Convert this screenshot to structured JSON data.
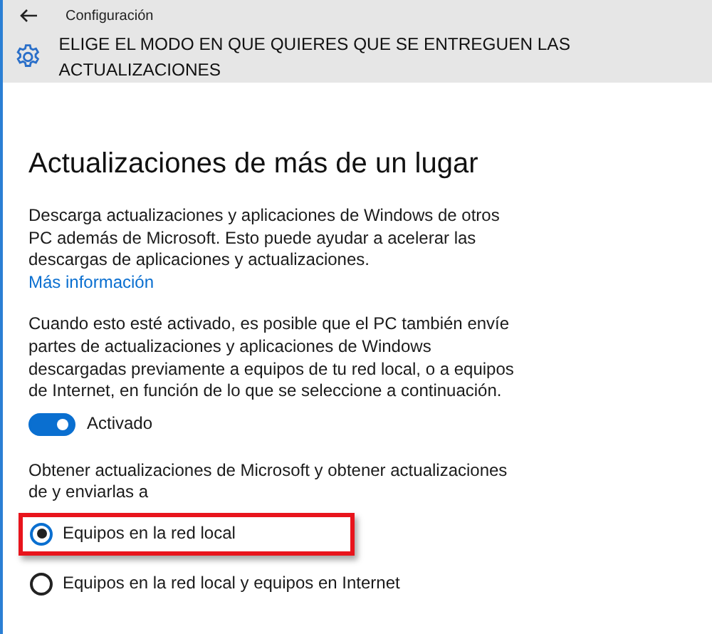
{
  "window": {
    "title": "Configuración"
  },
  "header": {
    "title": "ELIGE EL MODO EN QUE QUIERES QUE SE ENTREGUEN LAS ACTUALIZACIONES"
  },
  "section": {
    "heading": "Actualizaciones de más de un lugar",
    "description": "Descarga actualizaciones y aplicaciones de Windows de otros PC además de Microsoft. Esto puede ayudar a acelerar las descargas de aplicaciones y actualizaciones.",
    "link": "Más información",
    "note": "Cuando esto esté activado, es posible que el PC también envíe partes de actualizaciones y aplicaciones de Windows descargadas previamente a equipos de tu red local, o a equipos de Internet, en función de lo que se seleccione a continuación.",
    "toggle": {
      "label": "Activado",
      "on": true
    },
    "options_label": "Obtener actualizaciones de Microsoft y obtener actualizaciones de y enviarlas a",
    "options": [
      {
        "label": "Equipos en la red local",
        "selected": true,
        "highlighted": true
      },
      {
        "label": "Equipos en la red local y equipos en Internet",
        "selected": false,
        "highlighted": false
      }
    ]
  }
}
